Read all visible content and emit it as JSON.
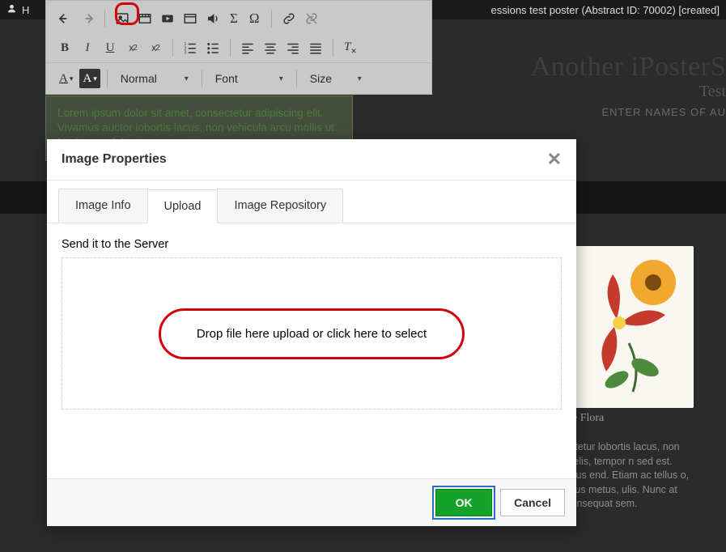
{
  "topbar": {
    "home_letter": "H",
    "right_status": "essions test poster (Abstract ID: 70002) [created]"
  },
  "poster": {
    "title": "Another iPosterS",
    "subtitle": "Test",
    "authors": "ENTER NAMES OF AU"
  },
  "editor": {
    "font_style": "Normal",
    "font_family": "Font",
    "font_size": "Size"
  },
  "lorem_box": "Lorem ipsum dolor sit amet, consectetur adipiscing elit. Vivamus auctor lobortis lacus, non vehicula arcu mollis ut. Morbi arcu felis, tempor eget",
  "flower_caption": "e Flora",
  "bg_lorem": "onsectetur lobortis lacus, non arcu felis, tempor n sed est. Vivamus end. Etiam ac tellus o, faucibus metus, ulis. Nunc at urna onsequat sem.",
  "modal": {
    "title": "Image Properties",
    "tabs": {
      "info": "Image Info",
      "upload": "Upload",
      "repo": "Image Repository"
    },
    "send_label": "Send it to the Server",
    "drop_text": "Drop file here upload or click here to select",
    "ok": "OK",
    "cancel": "Cancel"
  }
}
